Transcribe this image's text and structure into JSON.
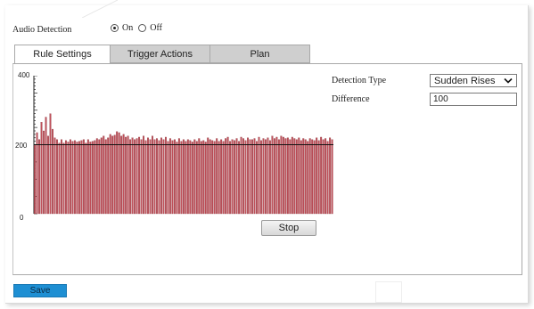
{
  "audio_detection": {
    "label": "Audio Detection",
    "options": [
      {
        "label": "On",
        "selected": true
      },
      {
        "label": "Off",
        "selected": false
      }
    ]
  },
  "tabs": [
    {
      "label": "Rule Settings",
      "active": true
    },
    {
      "label": "Trigger Actions",
      "active": false
    },
    {
      "label": "Plan",
      "active": false
    }
  ],
  "chart": {
    "y_ticks": [
      "400",
      "200",
      "0"
    ],
    "ylim": [
      0,
      400
    ],
    "threshold": 200,
    "bar_color": "#c0505a",
    "bar_stroke": "#8a2e36",
    "values": [
      200,
      235,
      215,
      265,
      240,
      280,
      225,
      290,
      245,
      220,
      215,
      205,
      215,
      205,
      212,
      208,
      215,
      210,
      212,
      208,
      210,
      212,
      215,
      205,
      215,
      208,
      210,
      212,
      218,
      215,
      220,
      225,
      215,
      220,
      230,
      225,
      228,
      238,
      235,
      225,
      230,
      222,
      225,
      215,
      220,
      215,
      218,
      222,
      215,
      225,
      212,
      220,
      215,
      225,
      215,
      218,
      212,
      220,
      215,
      222,
      210,
      218,
      212,
      215,
      208,
      218,
      210,
      215,
      210,
      215,
      212,
      208,
      215,
      210,
      218,
      210,
      212,
      208,
      220,
      215,
      212,
      210,
      218,
      210,
      215,
      210,
      218,
      222,
      210,
      215,
      212,
      218,
      210,
      222,
      218,
      212,
      220,
      215,
      215,
      218,
      210,
      222,
      212,
      218,
      215,
      220,
      212,
      225,
      218,
      222,
      215,
      225,
      222,
      218,
      220,
      215,
      222,
      218,
      215,
      220,
      212,
      218,
      215,
      210,
      218,
      215,
      212,
      220,
      212,
      222,
      215,
      218,
      210,
      220,
      215
    ]
  },
  "stop_label": "Stop",
  "detection_type": {
    "label": "Detection Type",
    "value": "Sudden Rises"
  },
  "difference": {
    "label": "Difference",
    "value": "100"
  },
  "save_label": "Save",
  "colors": {
    "accent": "#1e8fd3",
    "tab_inactive": "#cfcfcf"
  },
  "icons": {
    "select_arrow": "chevron-down-icon"
  }
}
